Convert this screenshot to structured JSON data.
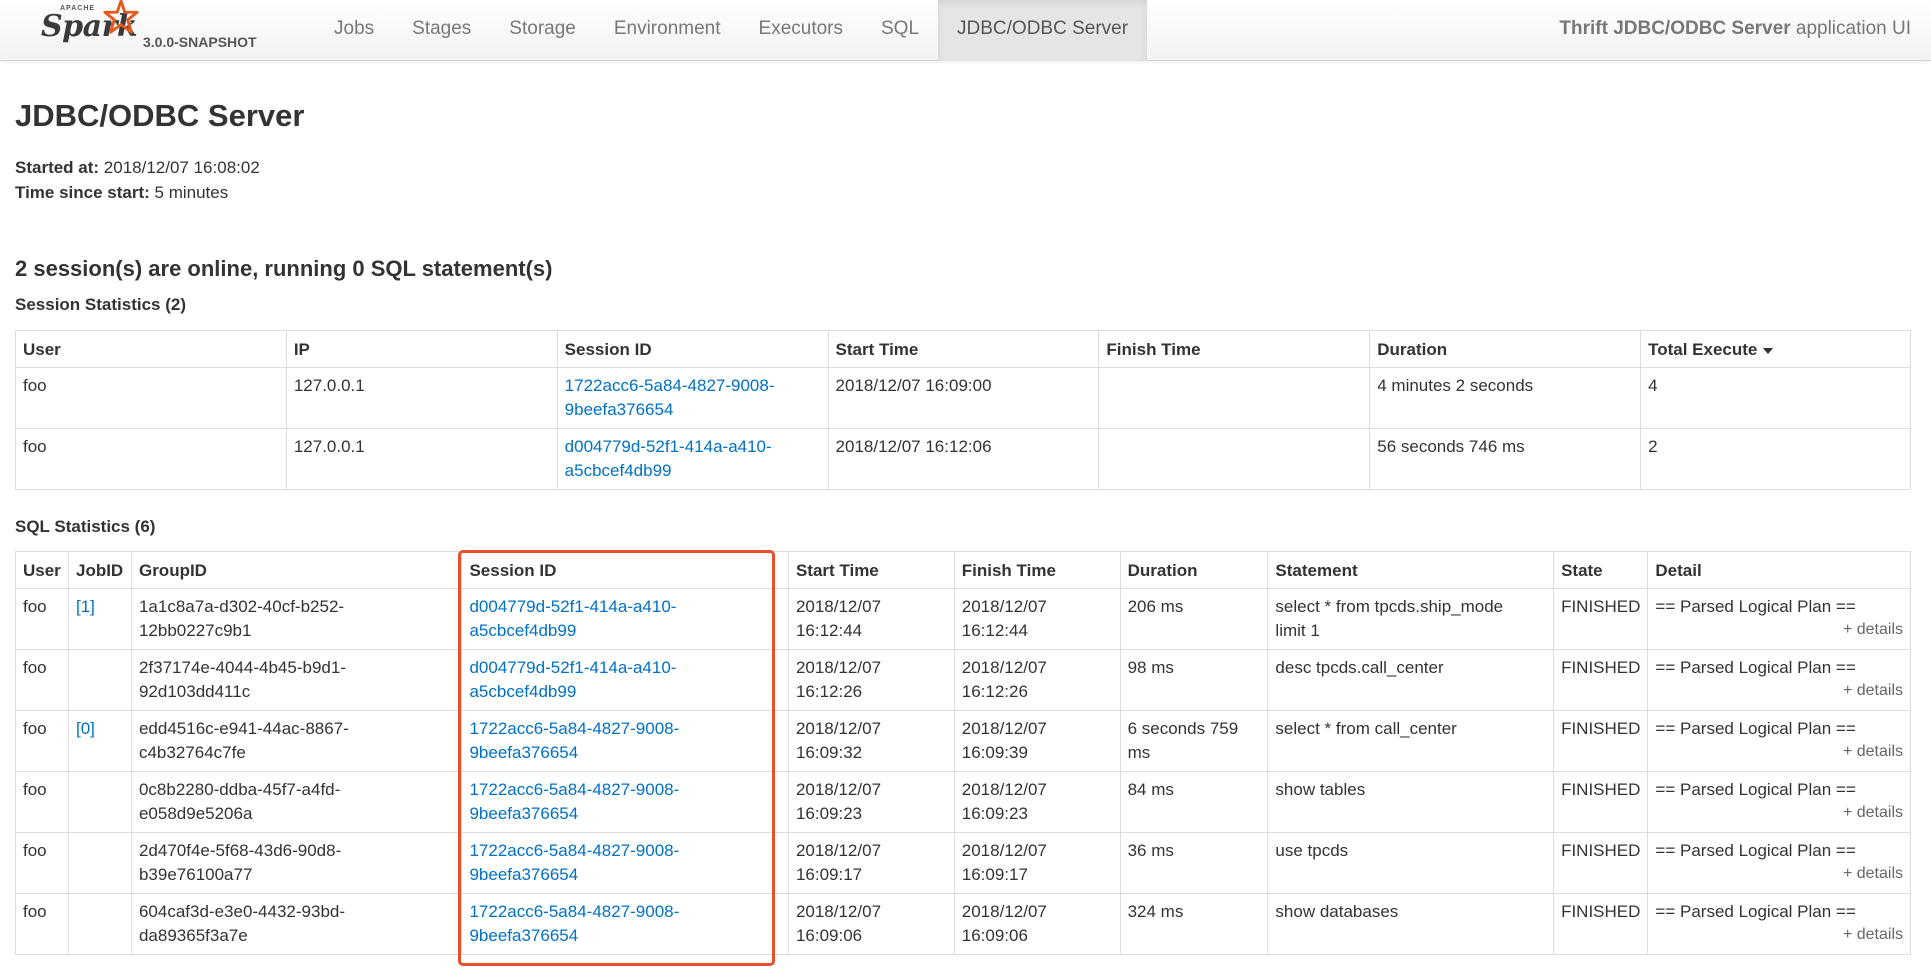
{
  "brand": {
    "apache": "APACHE",
    "name": "Spark",
    "version": "3.0.0-SNAPSHOT"
  },
  "nav": {
    "items": [
      {
        "label": "Jobs"
      },
      {
        "label": "Stages"
      },
      {
        "label": "Storage"
      },
      {
        "label": "Environment"
      },
      {
        "label": "Executors"
      },
      {
        "label": "SQL"
      },
      {
        "label": "JDBC/ODBC Server"
      }
    ],
    "active": "JDBC/ODBC Server"
  },
  "app_title": {
    "bold": "Thrift JDBC/ODBC Server",
    "rest": " application UI"
  },
  "page": {
    "title": "JDBC/ODBC Server",
    "started_label": "Started at:",
    "started_value": " 2018/12/07 16:08:02",
    "since_label": "Time since start:",
    "since_value": " 5 minutes",
    "summary": "2 session(s) are online, running 0 SQL statement(s)"
  },
  "session_stats": {
    "heading": "Session Statistics (2)",
    "columns": [
      "User",
      "IP",
      "Session ID",
      "Start Time",
      "Finish Time",
      "Duration",
      "Total Execute"
    ],
    "rows": [
      {
        "user": "foo",
        "ip": "127.0.0.1",
        "session_l1": "1722acc6-5a84-4827-9008-",
        "session_l2": "9beefa376654",
        "start": "2018/12/07 16:09:00",
        "finish": "",
        "duration": "4 minutes 2 seconds",
        "total": "4"
      },
      {
        "user": "foo",
        "ip": "127.0.0.1",
        "session_l1": "d004779d-52f1-414a-a410-",
        "session_l2": "a5cbcef4db99",
        "start": "2018/12/07 16:12:06",
        "finish": "",
        "duration": "56 seconds 746 ms",
        "total": "2"
      }
    ]
  },
  "sql_stats": {
    "heading": "SQL Statistics (6)",
    "columns": [
      "User",
      "JobID",
      "GroupID",
      "Session ID",
      "Start Time",
      "Finish Time",
      "Duration",
      "Statement",
      "State",
      "Detail"
    ],
    "detail_more": "+ details",
    "rows": [
      {
        "user": "foo",
        "job": "[1]",
        "group_l1": "1a1c8a7a-d302-40cf-b252-",
        "group_l2": "12bb0227c9b1",
        "session_l1": "d004779d-52f1-414a-a410-",
        "session_l2": "a5cbcef4db99",
        "start_l1": "2018/12/07",
        "start_l2": "16:12:44",
        "finish_l1": "2018/12/07",
        "finish_l2": "16:12:44",
        "duration_l1": "206 ms",
        "duration_l2": "",
        "stmt_l1": "select * from tpcds.ship_mode",
        "stmt_l2": "limit 1",
        "state": "FINISHED",
        "detail": "== Parsed Logical Plan =="
      },
      {
        "user": "foo",
        "job": "",
        "group_l1": "2f37174e-4044-4b45-b9d1-",
        "group_l2": "92d103dd411c",
        "session_l1": "d004779d-52f1-414a-a410-",
        "session_l2": "a5cbcef4db99",
        "start_l1": "2018/12/07",
        "start_l2": "16:12:26",
        "finish_l1": "2018/12/07",
        "finish_l2": "16:12:26",
        "duration_l1": "98 ms",
        "duration_l2": "",
        "stmt_l1": "desc tpcds.call_center",
        "stmt_l2": "",
        "state": "FINISHED",
        "detail": "== Parsed Logical Plan =="
      },
      {
        "user": "foo",
        "job": "[0]",
        "group_l1": "edd4516c-e941-44ac-8867-",
        "group_l2": "c4b32764c7fe",
        "session_l1": "1722acc6-5a84-4827-9008-",
        "session_l2": "9beefa376654",
        "start_l1": "2018/12/07",
        "start_l2": "16:09:32",
        "finish_l1": "2018/12/07",
        "finish_l2": "16:09:39",
        "duration_l1": "6 seconds 759",
        "duration_l2": "ms",
        "stmt_l1": "select * from call_center",
        "stmt_l2": "",
        "state": "FINISHED",
        "detail": "== Parsed Logical Plan =="
      },
      {
        "user": "foo",
        "job": "",
        "group_l1": "0c8b2280-ddba-45f7-a4fd-",
        "group_l2": "e058d9e5206a",
        "session_l1": "1722acc6-5a84-4827-9008-",
        "session_l2": "9beefa376654",
        "start_l1": "2018/12/07",
        "start_l2": "16:09:23",
        "finish_l1": "2018/12/07",
        "finish_l2": "16:09:23",
        "duration_l1": "84 ms",
        "duration_l2": "",
        "stmt_l1": "show tables",
        "stmt_l2": "",
        "state": "FINISHED",
        "detail": "== Parsed Logical Plan =="
      },
      {
        "user": "foo",
        "job": "",
        "group_l1": "2d470f4e-5f68-43d6-90d8-",
        "group_l2": "b39e76100a77",
        "session_l1": "1722acc6-5a84-4827-9008-",
        "session_l2": "9beefa376654",
        "start_l1": "2018/12/07",
        "start_l2": "16:09:17",
        "finish_l1": "2018/12/07",
        "finish_l2": "16:09:17",
        "duration_l1": "36 ms",
        "duration_l2": "",
        "stmt_l1": "use tpcds",
        "stmt_l2": "",
        "state": "FINISHED",
        "detail": "== Parsed Logical Plan =="
      },
      {
        "user": "foo",
        "job": "",
        "group_l1": "604caf3d-e3e0-4432-93bd-",
        "group_l2": "da89365f3a7e",
        "session_l1": "1722acc6-5a84-4827-9008-",
        "session_l2": "9beefa376654",
        "start_l1": "2018/12/07",
        "start_l2": "16:09:06",
        "finish_l1": "2018/12/07",
        "finish_l2": "16:09:06",
        "duration_l1": "324 ms",
        "duration_l2": "",
        "stmt_l1": "show databases",
        "stmt_l2": "",
        "state": "FINISHED",
        "detail": "== Parsed Logical Plan =="
      }
    ]
  },
  "colors": {
    "link": "#0071c5",
    "highlight": "#e8502d",
    "spark_star": "#e25a1c"
  }
}
